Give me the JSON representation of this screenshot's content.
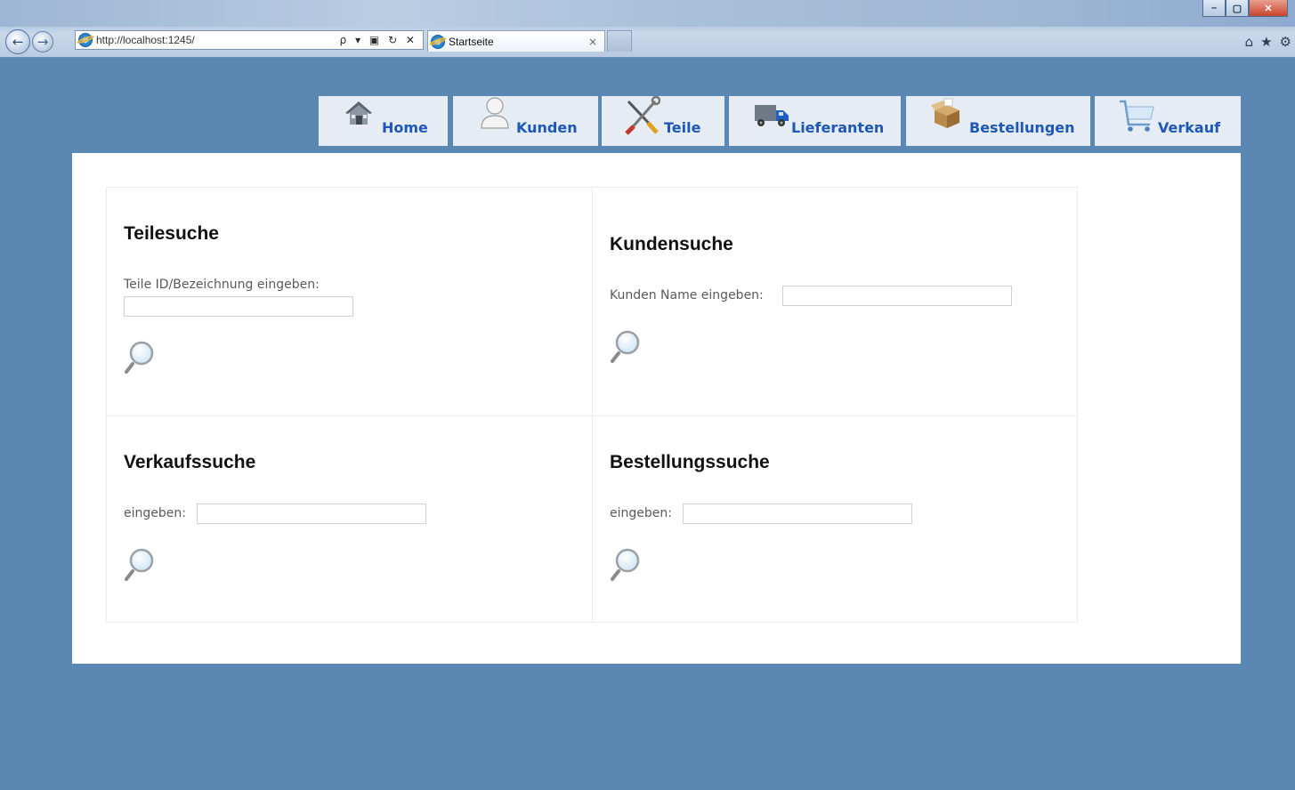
{
  "browser": {
    "url": "http://localhost:1245/",
    "tab_title": "Startseite",
    "address_tools": "ρ ▾ ▣ ↻ ✕",
    "tab_close": "×",
    "window_controls": {
      "minimize": "–",
      "maximize": "▢",
      "close": "✕"
    },
    "nav_back": "←",
    "nav_forward": "→",
    "right_tools": {
      "home": "⌂",
      "favorites": "★",
      "settings": "⚙"
    }
  },
  "nav": [
    {
      "label": "Home",
      "icon": "house-icon"
    },
    {
      "label": "Kunden",
      "icon": "user-icon"
    },
    {
      "label": "Teile",
      "icon": "tools-icon"
    },
    {
      "label": "Lieferanten",
      "icon": "truck-icon"
    },
    {
      "label": "Bestellungen",
      "icon": "box-icon"
    },
    {
      "label": "Verkauf",
      "icon": "cart-icon"
    }
  ],
  "panels": {
    "teilesuche": {
      "title": "Teilesuche",
      "label": "Teile ID/Bezeichnung eingeben:",
      "value": "",
      "icon": "search-icon"
    },
    "kundensuche": {
      "title": "Kundensuche",
      "label": "Kunden Name eingeben:",
      "value": "",
      "icon": "search-icon"
    },
    "verkaufssuche": {
      "title": "Verkaufssuche",
      "label": "eingeben:",
      "value": "",
      "icon": "search-icon"
    },
    "bestellungssuche": {
      "title": "Bestellungssuche",
      "label": "eingeben:",
      "value": "",
      "icon": "search-icon"
    }
  },
  "colors": {
    "page_background": "#5b87b3",
    "nav_background": "#e6ecf3",
    "nav_text": "#1e57b8",
    "content_background": "#ffffff"
  }
}
